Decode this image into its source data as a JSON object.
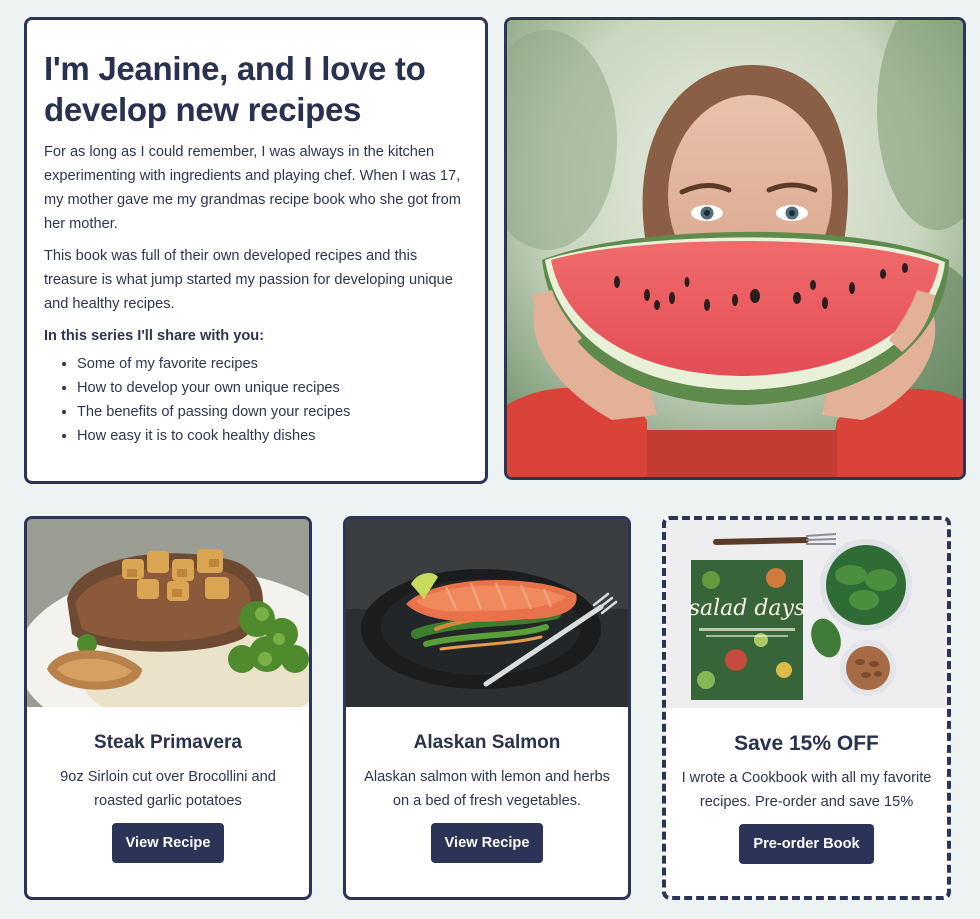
{
  "intro": {
    "heading": "I'm Jeanine, and I love to develop new recipes",
    "paragraph1": "For as long as I could remember, I was always in the kitchen experimenting with ingredients and playing chef. When I was 17, my mother gave me my grandmas recipe book who she got from her mother.",
    "paragraph2": "This book was full of their own developed recipes and this treasure is what jump started my passion for developing unique and healthy recipes.",
    "list_title": "In this series I'll share with you:",
    "list": [
      "Some of my favorite recipes",
      "How to develop your own unique recipes",
      "The benefits of passing down your recipes",
      "How easy it is to cook healthy dishes"
    ]
  },
  "recipes": [
    {
      "title": "Steak Primavera",
      "description": "9oz Sirloin cut over Brocollini and roasted garlic potatoes",
      "button": "View Recipe"
    },
    {
      "title": "Alaskan Salmon",
      "description": "Alaskan salmon with lemon and herbs on a bed of fresh vegetables.",
      "button": "View Recipe"
    }
  ],
  "promo": {
    "title": "Save 15% OFF",
    "description": "I wrote a Cookbook with all my favorite recipes. Pre-order and save 15%",
    "button": "Pre-order Book",
    "book_cover_text": "salad days"
  },
  "colors": {
    "navy": "#2b3357",
    "background": "#edf3f2",
    "card": "#ffffff"
  }
}
